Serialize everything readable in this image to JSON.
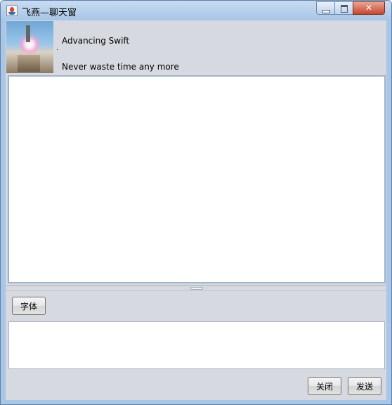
{
  "window": {
    "title": "飞燕—聊天窗"
  },
  "profile": {
    "name": "Advancing Swift",
    "signature": "Never waste time any more"
  },
  "toolbar": {
    "font_label": "字体"
  },
  "actions": {
    "close_label": "关闭",
    "send_label": "发送"
  },
  "chat": {
    "history_text": "",
    "input_value": ""
  },
  "colors": {
    "titlebar": "#a9c6e6",
    "client_bg": "#d6d9df",
    "close_button": "#c6472f",
    "text_area_border": "#9fb4cc"
  }
}
